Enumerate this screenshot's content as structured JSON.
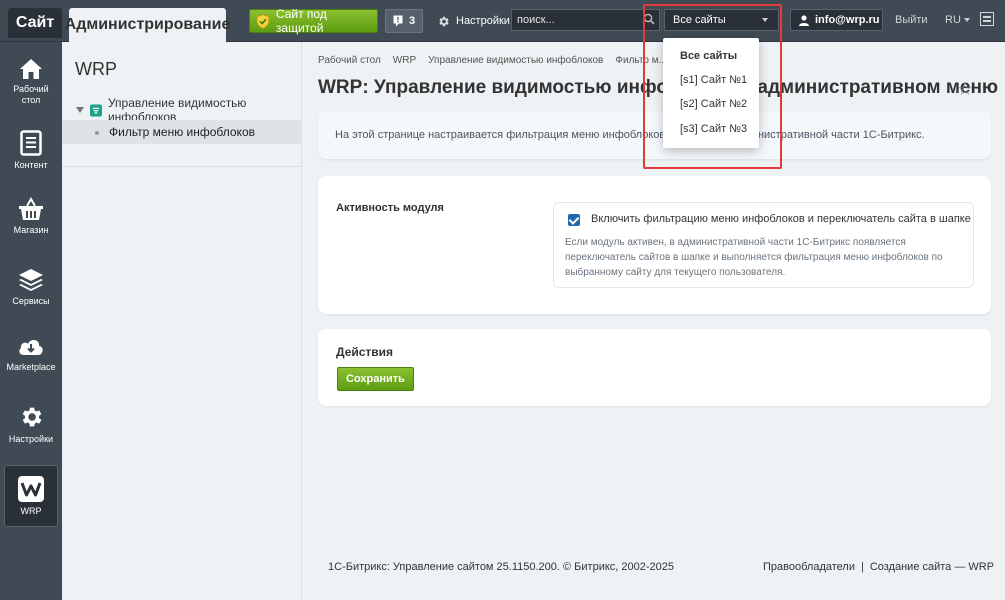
{
  "topbar": {
    "tab_site": "Сайт",
    "tab_admin": "Администрирование",
    "secure_label": "Сайт под защитой",
    "notifications_count": "3",
    "settings_label": "Настройки",
    "search_placeholder": "поиск...",
    "site_select_value": "Все сайты",
    "user_label": "info@wrp.ru",
    "logout_label": "Выйти",
    "lang_label": "RU"
  },
  "site_dropdown": {
    "options": [
      "Все сайты",
      "[s1] Сайт №1",
      "[s2] Сайт №2",
      "[s3] Сайт №3"
    ]
  },
  "leftnav": {
    "items": [
      {
        "label": "Рабочий стол",
        "icon": "home-icon"
      },
      {
        "label": "Контент",
        "icon": "document-icon"
      },
      {
        "label": "Магазин",
        "icon": "basket-icon"
      },
      {
        "label": "Сервисы",
        "icon": "layers-icon"
      },
      {
        "label": "Marketplace",
        "icon": "cloud-download-icon"
      },
      {
        "label": "Настройки",
        "icon": "gear-icon"
      },
      {
        "label": "WRP",
        "icon": "wrp-logo-icon"
      }
    ]
  },
  "sidepanel": {
    "title": "WRP",
    "parent_item": "Управление видимостью инфоблоков",
    "child_item": "Фильтр меню инфоблоков"
  },
  "breadcrumb": [
    "Рабочий стол",
    "WRP",
    "Управление видимостью инфоблоков",
    "Фильтр м..."
  ],
  "page": {
    "title": "WRP: Управление видимостью инфоблоков в административном меню",
    "info_text": "На этой странице настраивается фильтрация меню инфоблоков по сайтам в административной части 1С-Битрикс.",
    "module_label": "Активность модуля",
    "checkbox_label": "Включить фильтрацию меню инфоблоков и переключатель сайта в шапке",
    "help_text": "Если модуль активен, в административной части 1С-Битрикс появляется переключатель сайтов в шапке и выполняется фильтрация меню инфоблоков по выбранному сайту для текущего пользователя.",
    "actions_title": "Действия",
    "save_label": "Сохранить"
  },
  "footer": {
    "copyright": "1С-Битрикс: Управление сайтом 25.1150.200. © Битрикс, 2002-2025",
    "link1": "Правообладатели",
    "separator": "|",
    "link2": "Создание сайта — WRP"
  },
  "colors": {
    "topbar_bg": "#3f4a55",
    "accent_green": "#6fae1c",
    "highlight_red": "#e03a3a"
  }
}
